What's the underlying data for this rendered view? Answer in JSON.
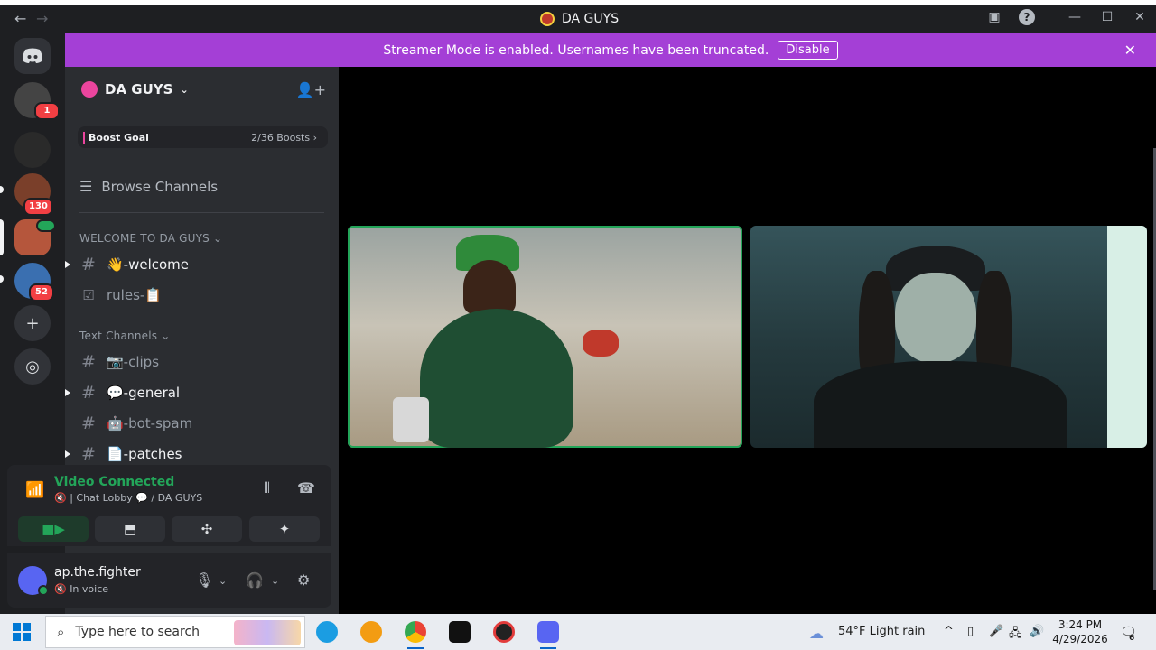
{
  "window": {
    "title": "DA GUYS"
  },
  "banner": {
    "message": "Streamer Mode is enabled. Usernames have been truncated.",
    "disable_label": "Disable"
  },
  "server_rail": {
    "badges": [
      "1",
      "130",
      "52"
    ]
  },
  "guild": {
    "name": "DA GUYS",
    "boost_goal_label": "Boost Goal",
    "boost_progress": "2/36 Boosts",
    "browse_channels": "Browse Channels",
    "categories": [
      {
        "name": "WELCOME TO DA GUYS",
        "channels": [
          {
            "name": "👋-welcome",
            "unread": true,
            "icon": "hash-icon"
          },
          {
            "name": "rules-📋",
            "unread": false,
            "icon": "rules-checkbox-icon"
          }
        ]
      },
      {
        "name": "Text Channels",
        "channels": [
          {
            "name": "📷-clips",
            "unread": false,
            "icon": "hash-icon"
          },
          {
            "name": "💬-general",
            "unread": true,
            "icon": "hash-icon"
          },
          {
            "name": "🤖-bot-spam",
            "unread": false,
            "icon": "hash-icon"
          },
          {
            "name": "📄-patches",
            "unread": true,
            "icon": "hash-icon"
          }
        ]
      }
    ]
  },
  "voice": {
    "status": "Video Connected",
    "channel": "🔇 | Chat Lobby 💬 / DA GUYS"
  },
  "user": {
    "name": "ap.the.fighter",
    "status": "🔇 In voice"
  },
  "taskbar": {
    "search_placeholder": "Type here to search",
    "weather": "54°F  Light rain",
    "time": "3:24 PM",
    "date": "4/29/2026",
    "notification_count": "6"
  },
  "colors": {
    "banner": "#a43fd6",
    "speaking_outline": "#23a559",
    "sidebar": "#2b2d31",
    "rail": "#1e1f22"
  }
}
